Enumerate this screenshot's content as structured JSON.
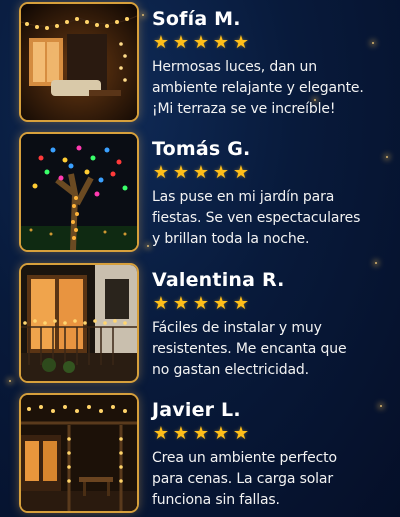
{
  "reviews": [
    {
      "name": "Sofía M.",
      "rating": 5,
      "text": "Hermosas luces, dan un\nambiente relajante y elegante.\n¡Mi terraza se ve increíble!",
      "image_icon": "terrace-lights-photo"
    },
    {
      "name": "Tomás G.",
      "rating": 5,
      "text": "Las puse en mi jardín para\nfiestas. Se ven espectaculares\ny brillan toda la noche.",
      "image_icon": "garden-tree-lights-photo"
    },
    {
      "name": "Valentina R.",
      "rating": 5,
      "text": "Fáciles de instalar y muy\nresistentes. Me encanta que\nno gastan electricidad.",
      "image_icon": "balcony-lights-photo"
    },
    {
      "name": "Javier L.",
      "rating": 5,
      "text": "Crea un ambiente perfecto\npara cenas. La carga solar\nfunciona sin fallas.",
      "image_icon": "pergola-lights-photo"
    }
  ],
  "star_glyph": "★",
  "colors": {
    "background": "#081a3b",
    "accent_gold": "#ffbf1a",
    "frame": "#d7a03c"
  }
}
